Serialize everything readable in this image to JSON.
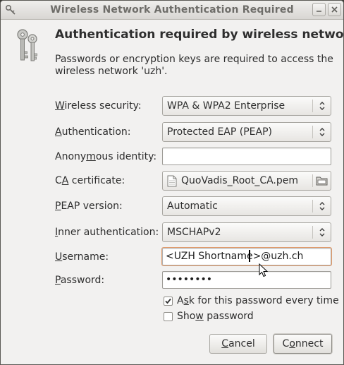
{
  "window": {
    "title": "Wireless Network Authentication Required"
  },
  "dialog": {
    "heading": "Authentication required by wireless network",
    "description": "Passwords or encryption keys are required to access the wireless network 'uzh'."
  },
  "form": {
    "wireless_security": {
      "mnemonic": "W",
      "label_rest": "ireless security:",
      "value": "WPA & WPA2 Enterprise"
    },
    "authentication": {
      "mnemonic": "A",
      "label_rest": "uthentication:",
      "value": "Protected EAP (PEAP)"
    },
    "anonymous_identity": {
      "label_pre": "Anony",
      "mnemonic": "m",
      "label_post": "ous identity:",
      "value": ""
    },
    "ca_certificate": {
      "label_pre": "C",
      "mnemonic": "A",
      "label_post": " certificate:",
      "value": "QuoVadis_Root_CA.pem"
    },
    "peap_version": {
      "mnemonic": "P",
      "label_rest": "EAP version:",
      "value": "Automatic"
    },
    "inner_authentication": {
      "mnemonic": "I",
      "label_rest": "nner authentication:",
      "value": "MSCHAPv2"
    },
    "username": {
      "mnemonic": "U",
      "label_rest": "sername:",
      "value": "<UZH Shortname>@uzh.ch"
    },
    "password": {
      "mnemonic": "P",
      "label_rest": "assword:",
      "value": "••••••••"
    },
    "ask_password": {
      "label_pre": "A",
      "mnemonic": "s",
      "label_post": "k for this password every time",
      "checked": true
    },
    "show_password": {
      "label_pre": "Sho",
      "mnemonic": "w",
      "label_post": " password",
      "checked": false
    }
  },
  "buttons": {
    "cancel": {
      "mnemonic": "C",
      "label_rest": "ancel"
    },
    "connect": {
      "label_pre": "C",
      "mnemonic": "o",
      "label_post": "nnect"
    }
  },
  "icons": {
    "window_icon": "key-icon",
    "dialog_icon": "keys-icon",
    "file_icon": "document-icon",
    "folder_icon": "folder-icon",
    "combo_arrows": "up-down-arrows-icon"
  },
  "colors": {
    "window_bg": "#f2f1f0",
    "focus_ring": "#e29b6a",
    "titlebar_text": "#6e6d69"
  }
}
